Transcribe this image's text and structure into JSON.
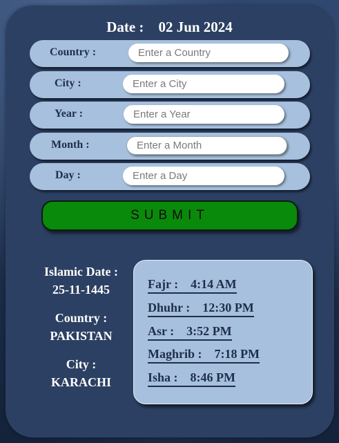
{
  "header": {
    "date_label": "Date :",
    "date_value": "02 Jun 2024"
  },
  "form": {
    "country": {
      "label": "Country :",
      "placeholder": "Enter a Country"
    },
    "city": {
      "label": "City :",
      "placeholder": "Enter a City"
    },
    "year": {
      "label": "Year :",
      "placeholder": "Enter a Year"
    },
    "month": {
      "label": "Month :",
      "placeholder": "Enter a Month"
    },
    "day": {
      "label": "Day :",
      "placeholder": "Enter a Day"
    },
    "submit_label": "SUBMIT"
  },
  "info": {
    "islamic_date_label": "Islamic Date :",
    "islamic_date_value": "25-11-1445",
    "country_label": "Country :",
    "country_value": "PAKISTAN",
    "city_label": "City :",
    "city_value": "KARACHI"
  },
  "prayer_times": [
    {
      "name": "Fajr :",
      "time": "4:14 AM"
    },
    {
      "name": "Dhuhr :",
      "time": "12:30 PM"
    },
    {
      "name": "Asr :",
      "time": "3:52 PM"
    },
    {
      "name": "Maghrib :",
      "time": "7:18 PM"
    },
    {
      "name": "Isha :",
      "time": "8:46 PM"
    }
  ],
  "colors": {
    "card": "#2c4063",
    "row": "#a7c0dd",
    "submit": "#0a8a0a",
    "text_dark": "#1e2e4d"
  }
}
